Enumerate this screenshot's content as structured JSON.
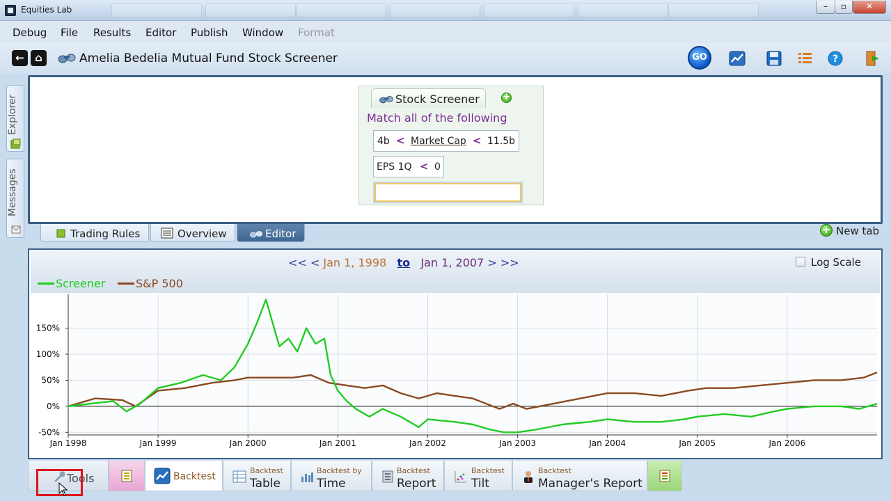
{
  "window": {
    "title": "Equities Lab",
    "controls": [
      "–",
      "▫",
      "✕"
    ]
  },
  "menu": {
    "items": [
      "Debug",
      "File",
      "Results",
      "Editor",
      "Publish",
      "Window"
    ],
    "disabled_item": "Format"
  },
  "toolbar": {
    "back_label": "←",
    "home_label": "⌂",
    "title": "Amelia Bedelia Mutual Fund Stock Screener",
    "go_label": "GO",
    "icons": [
      "go-icon",
      "chart-icon",
      "save-icon",
      "list-icon",
      "help-icon",
      "exit-icon"
    ]
  },
  "sidebar": {
    "explorer_label": "Explorer",
    "messages_label": "Messages"
  },
  "screener": {
    "tab_label": "Stock Screener",
    "match_text": "Match all of the following",
    "rules": [
      {
        "left": "4b",
        "op1": "<",
        "field": "Market Cap",
        "op2": "<",
        "right": "11.5b"
      },
      {
        "field": "EPS 1Q",
        "op": "<",
        "value": "0"
      }
    ],
    "input_value": ""
  },
  "mid_tabs": {
    "trading_rules": "Trading Rules",
    "overview": "Overview",
    "editor": "Editor",
    "new_tab": "New tab"
  },
  "chart_header": {
    "prev_far": "<<",
    "prev": "<",
    "start_date": "Jan 1, 1998",
    "to": "to",
    "end_date": "Jan 1, 2007",
    "next": ">",
    "next_far": ">>",
    "log_scale_label": "Log Scale",
    "log_scale_checked": false
  },
  "chart_data": {
    "type": "line",
    "xlabel": "",
    "ylabel": "",
    "ylim": [
      -55,
      215
    ],
    "xlim": [
      1998.0,
      2007.0
    ],
    "x_ticks": [
      "Jan 1998",
      "Jan 1999",
      "Jan 2000",
      "Jan 2001",
      "Jan 2002",
      "Jan 2003",
      "Jan 2004",
      "Jan 2005",
      "Jan 2006"
    ],
    "y_ticks": [
      "-50%",
      "0%",
      "50%",
      "100%",
      "150%"
    ],
    "y_tick_values": [
      -50,
      0,
      50,
      100,
      150
    ],
    "grid": true,
    "legend": "top-left",
    "series": [
      {
        "name": "Screener",
        "color": "#22cc22",
        "x": [
          1998.0,
          1998.25,
          1998.5,
          1998.65,
          1998.8,
          1999.0,
          1999.25,
          1999.5,
          1999.7,
          1999.85,
          2000.0,
          2000.1,
          2000.2,
          2000.35,
          2000.45,
          2000.55,
          2000.65,
          2000.75,
          2000.85,
          2000.92,
          2001.0,
          2001.1,
          2001.2,
          2001.35,
          2001.5,
          2001.7,
          2001.9,
          2002.0,
          2002.3,
          2002.5,
          2002.7,
          2002.85,
          2003.0,
          2003.2,
          2003.5,
          2003.8,
          2004.0,
          2004.3,
          2004.6,
          2004.85,
          2005.0,
          2005.3,
          2005.6,
          2005.85,
          2006.0,
          2006.3,
          2006.6,
          2006.8,
          2007.0
        ],
        "values": [
          0,
          5,
          10,
          -10,
          5,
          35,
          45,
          60,
          50,
          75,
          120,
          160,
          205,
          115,
          130,
          105,
          150,
          120,
          130,
          60,
          30,
          10,
          -5,
          -20,
          -5,
          -20,
          -40,
          -25,
          -30,
          -35,
          -45,
          -50,
          -50,
          -45,
          -35,
          -30,
          -25,
          -30,
          -30,
          -25,
          -20,
          -15,
          -20,
          -10,
          -5,
          0,
          0,
          -5,
          5
        ]
      },
      {
        "name": "S&P 500",
        "color": "#8b4a22",
        "x": [
          1998.0,
          1998.3,
          1998.6,
          1998.75,
          1999.0,
          1999.3,
          1999.6,
          1999.85,
          2000.0,
          2000.25,
          2000.5,
          2000.7,
          2000.9,
          2001.1,
          2001.3,
          2001.5,
          2001.7,
          2001.9,
          2002.1,
          2002.3,
          2002.5,
          2002.65,
          2002.8,
          2002.95,
          2003.1,
          2003.4,
          2003.7,
          2004.0,
          2004.3,
          2004.6,
          2004.9,
          2005.1,
          2005.4,
          2005.7,
          2006.0,
          2006.3,
          2006.6,
          2006.85,
          2007.0
        ],
        "values": [
          0,
          15,
          12,
          0,
          30,
          35,
          45,
          50,
          55,
          55,
          55,
          60,
          45,
          40,
          35,
          40,
          25,
          15,
          25,
          20,
          15,
          5,
          -5,
          5,
          -5,
          5,
          15,
          25,
          25,
          20,
          30,
          35,
          35,
          40,
          45,
          50,
          50,
          55,
          65
        ]
      }
    ]
  },
  "bottom_tabs": {
    "tools": "Tools",
    "backtest": "Backtest",
    "table_small": "Backtest",
    "table_big": "Table",
    "time_small": "Backtest by",
    "time_big": "Time",
    "report_small": "Backtest",
    "report_big": "Report",
    "tilt_small": "Backtest",
    "tilt_big": "Tilt",
    "manager_small": "Backtest",
    "manager_big": "Manager's Report"
  }
}
